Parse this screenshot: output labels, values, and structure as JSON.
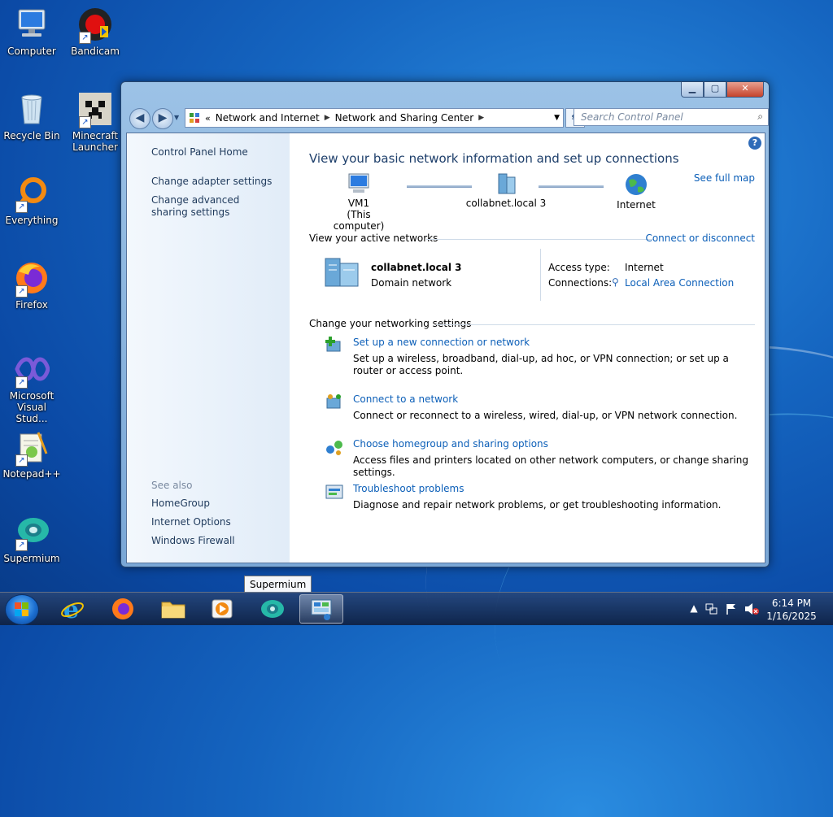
{
  "desktop": {
    "icons": [
      {
        "label": "Computer"
      },
      {
        "label": "Bandicam"
      },
      {
        "label": "Recycle Bin"
      },
      {
        "label": "Minecraft Launcher"
      },
      {
        "label": "Everything"
      },
      {
        "label": "Firefox"
      },
      {
        "label": "Microsoft Visual Stud..."
      },
      {
        "label": "Notepad++"
      },
      {
        "label": "Supermium"
      }
    ]
  },
  "window": {
    "address": {
      "crumbs": [
        "Network and Internet",
        "Network and Sharing Center"
      ]
    },
    "search_placeholder": "Search Control Panel",
    "left_pane": {
      "home": "Control Panel Home",
      "links": [
        "Change adapter settings",
        "Change advanced sharing settings"
      ],
      "see_also_label": "See also",
      "see_also": [
        "HomeGroup",
        "Internet Options",
        "Windows Firewall"
      ]
    },
    "main": {
      "title": "View your basic network information and set up connections",
      "see_full_map": "See full map",
      "map": {
        "computer_name": "VM1",
        "computer_sub": "(This computer)",
        "network": "collabnet.local  3",
        "internet": "Internet"
      },
      "active_networks_header": "View your active networks",
      "connect_disconnect": "Connect or disconnect",
      "active_network": {
        "name": "collabnet.local  3",
        "category": "Domain network",
        "access_type_label": "Access type:",
        "access_type_value": "Internet",
        "connections_label": "Connections:",
        "connections_value": "Local Area Connection"
      },
      "settings_header": "Change your networking settings",
      "tasks": [
        {
          "title": "Set up a new connection or network",
          "desc": "Set up a wireless, broadband, dial-up, ad hoc, or VPN connection; or set up a router or access point."
        },
        {
          "title": "Connect to a network",
          "desc": "Connect or reconnect to a wireless, wired, dial-up, or VPN network connection."
        },
        {
          "title": "Choose homegroup and sharing options",
          "desc": "Access files and printers located on other network computers, or change sharing settings."
        },
        {
          "title": "Troubleshoot problems",
          "desc": "Diagnose and repair network problems, or get troubleshooting information."
        }
      ]
    }
  },
  "tooltip": "Supermium",
  "taskbar": {
    "time": "6:14 PM",
    "date": "1/16/2025"
  },
  "colors": {
    "link": "#0c5fb8",
    "title": "#1e3f6b"
  }
}
